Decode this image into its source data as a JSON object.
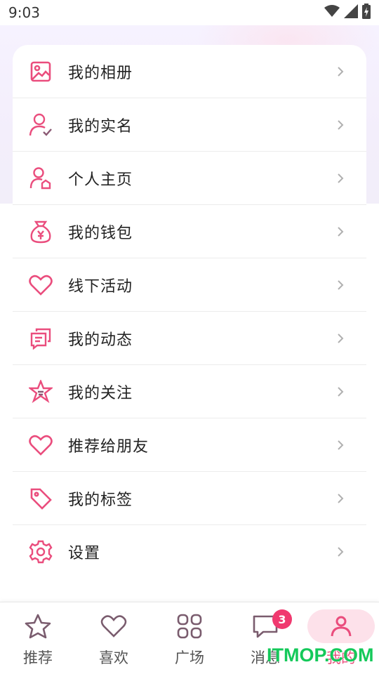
{
  "status_bar": {
    "time": "9:03"
  },
  "menu": {
    "items": [
      {
        "label": "我的相册",
        "icon": "photo-album-icon"
      },
      {
        "label": "我的实名",
        "icon": "user-verified-icon"
      },
      {
        "label": "个人主页",
        "icon": "user-home-icon"
      },
      {
        "label": "我的钱包",
        "icon": "money-bag-icon"
      },
      {
        "label": "线下活动",
        "icon": "heart-icon"
      },
      {
        "label": "我的动态",
        "icon": "posts-icon"
      },
      {
        "label": "我的关注",
        "icon": "star-list-icon"
      },
      {
        "label": "推荐给朋友",
        "icon": "heart-icon"
      },
      {
        "label": "我的标签",
        "icon": "tag-icon"
      },
      {
        "label": "设置",
        "icon": "gear-icon"
      }
    ]
  },
  "bottom_nav": {
    "items": [
      {
        "label": "推荐",
        "icon": "star-icon"
      },
      {
        "label": "喜欢",
        "icon": "heart-icon"
      },
      {
        "label": "广场",
        "icon": "grid-icon"
      },
      {
        "label": "消息",
        "icon": "chat-icon",
        "badge": "3"
      },
      {
        "label": "我的",
        "icon": "person-icon",
        "active": true
      }
    ]
  },
  "watermark": "ITMOP.COM",
  "colors": {
    "accent": "#ea4d7d",
    "badge": "#f0396f",
    "active_bg": "#fde1ea",
    "watermark": "#14c95a"
  }
}
